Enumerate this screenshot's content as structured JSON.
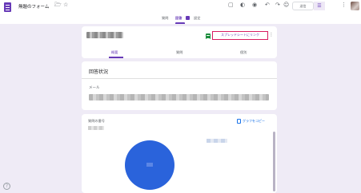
{
  "app": {
    "title": "無題のフォーム",
    "brand_color": "#673ab7"
  },
  "header": {
    "send_label": "送信",
    "icons": [
      "folder-icon",
      "star-icon",
      "customize-theme-icon",
      "palette-icon",
      "preview-icon",
      "undo-icon",
      "redo-icon",
      "link-icon",
      "add-collaborator-icon",
      "more-vert-icon"
    ]
  },
  "tabs": [
    {
      "label": "質問",
      "active": false
    },
    {
      "label": "回答",
      "active": true
    },
    {
      "label": "設定",
      "active": false
    }
  ],
  "summary": {
    "link_sheets_label": "スプレッドシートにリンク",
    "subtabs": [
      {
        "label": "概要",
        "active": true
      },
      {
        "label": "質問",
        "active": false
      },
      {
        "label": "個別",
        "active": false
      }
    ]
  },
  "status": {
    "title": "回答状況",
    "email_label": "メール"
  },
  "question_card": {
    "title": "質問の番号",
    "copy_label": "グラフをコピー"
  },
  "chart_data": {
    "type": "pie",
    "series": [
      {
        "values": [
          100
        ],
        "colors": [
          "#2a63db"
        ]
      }
    ],
    "title": "",
    "legend": "right"
  }
}
